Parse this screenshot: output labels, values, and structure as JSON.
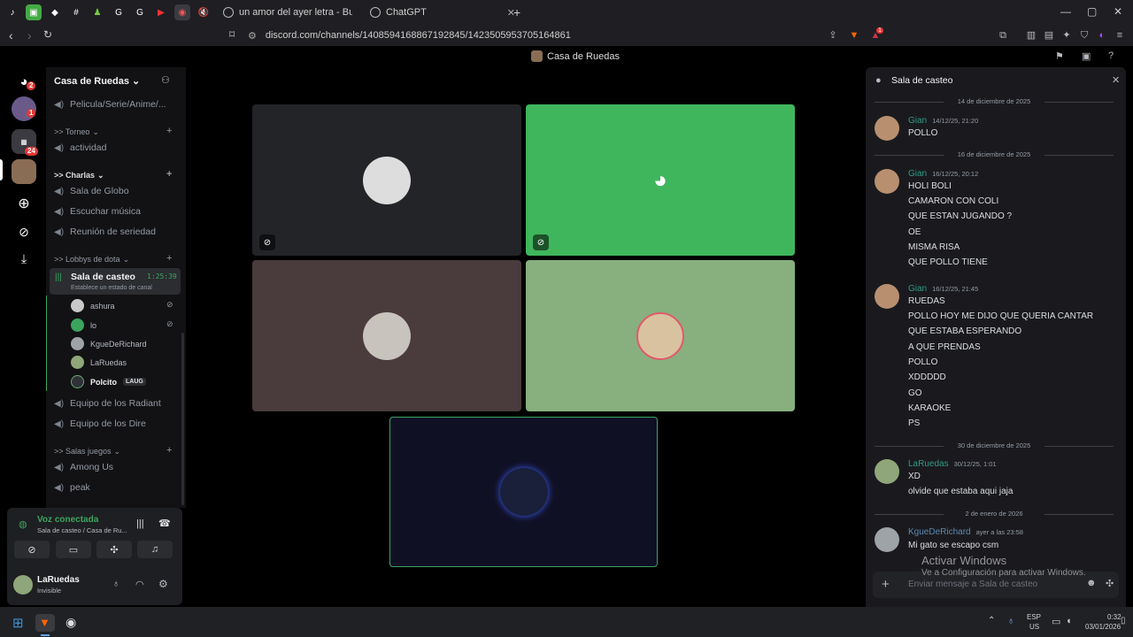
{
  "browser": {
    "tabs": [
      {
        "title": "un amor del ayer letra - Buscar con G"
      },
      {
        "title": "ChatGPT"
      }
    ],
    "new_tab": "+",
    "url": "discord.com/channels/1408594168867192845/1423505953705164861",
    "shields_badge": "1"
  },
  "discord": {
    "top_title": "Casa de Ruedas",
    "rail": {
      "badges": {
        "dm": "2",
        "server1": "1",
        "folder": "24"
      }
    },
    "server": {
      "name": "Casa de Ruedas",
      "channels_top": "Pelicula/Serie/Anime/...",
      "categories": [
        {
          "label": ">> Torneo"
        },
        {
          "label": ">> Charlas"
        },
        {
          "label": ">> Lobbys de dota"
        },
        {
          "label": ">> Salas juegos"
        }
      ],
      "actividad": "actividad",
      "charlas": [
        "Sala de Globo",
        "Escuchar música",
        "Reunión de seriedad"
      ],
      "active_channel": {
        "name": "Sala de casteo",
        "timer": "1:25:39",
        "status": "Establece un estado de canal"
      },
      "voice_users": [
        {
          "name": "ashura",
          "color": "#c9c9c9"
        },
        {
          "name": "lo",
          "color": "#3ba55d"
        },
        {
          "name": "KgueDeRichard",
          "color": "#9ea3a8"
        },
        {
          "name": "LaRuedas",
          "color": "#8fa67a"
        },
        {
          "name": "Polcito",
          "color": "#2f3136",
          "tag": "LAUG"
        }
      ],
      "dota_rest": [
        "Equipo de los Radiant",
        "Equipo de los Dire"
      ],
      "juegos": [
        "Among Us",
        "peak"
      ]
    },
    "voice_panel": {
      "status": "Voz conectada",
      "location": "Sala de casteo / Casa de Ru..."
    },
    "user": {
      "name": "LaRuedas",
      "status": "Invisible"
    },
    "chat": {
      "title": "Sala de casteo",
      "input_placeholder": "Enviar mensaje a Sala de casteo",
      "dates": [
        "14 de diciembre de 2025",
        "16 de diciembre de 2025",
        "30 de diciembre de 2025",
        "2 de enero de 2026"
      ],
      "messages": [
        {
          "author": "Gian",
          "time": "14/12/25, 21:20",
          "lines": [
            "POLLO"
          ]
        },
        {
          "author": "Gian",
          "time": "16/12/25, 20:12",
          "lines": [
            "HOLI BOLI",
            "CAMARON CON COLI",
            "QUE ESTAN JUGANDO ?",
            "OE",
            "MISMA RISA",
            "QUE POLLO TIENE"
          ]
        },
        {
          "author": "Gian",
          "time": "16/12/25, 21:45",
          "lines": [
            "RUEDAS",
            "POLLO HOY ME DIJO QUE QUERIA CANTAR",
            "QUE ESTABA ESPERANDO",
            "A QUE PRENDAS",
            "POLLO",
            "XDDDDD",
            "GO",
            "KARAOKE",
            "PS"
          ]
        },
        {
          "author": "LaRuedas",
          "time": "30/12/25, 1:01",
          "lines": [
            "XD",
            "olvide que estaba aqui jaja"
          ]
        },
        {
          "author": "KgueDeRichard",
          "time": "ayer a las 23:58",
          "lines": [
            "Mi gato se escapo csm"
          ]
        }
      ]
    },
    "tiles": [
      {
        "bg": "#232428"
      },
      {
        "bg": "#3fb65c"
      },
      {
        "bg": "#4a3b3c"
      },
      {
        "bg": "#87b07e"
      },
      {
        "bg": "#101025"
      }
    ]
  },
  "watermark": {
    "title": "Activar Windows",
    "subtitle": "Ve a Configuración para activar Windows."
  },
  "taskbar": {
    "lang": "ESP",
    "region": "US",
    "time": "0:32",
    "date": "03/01/2026"
  }
}
